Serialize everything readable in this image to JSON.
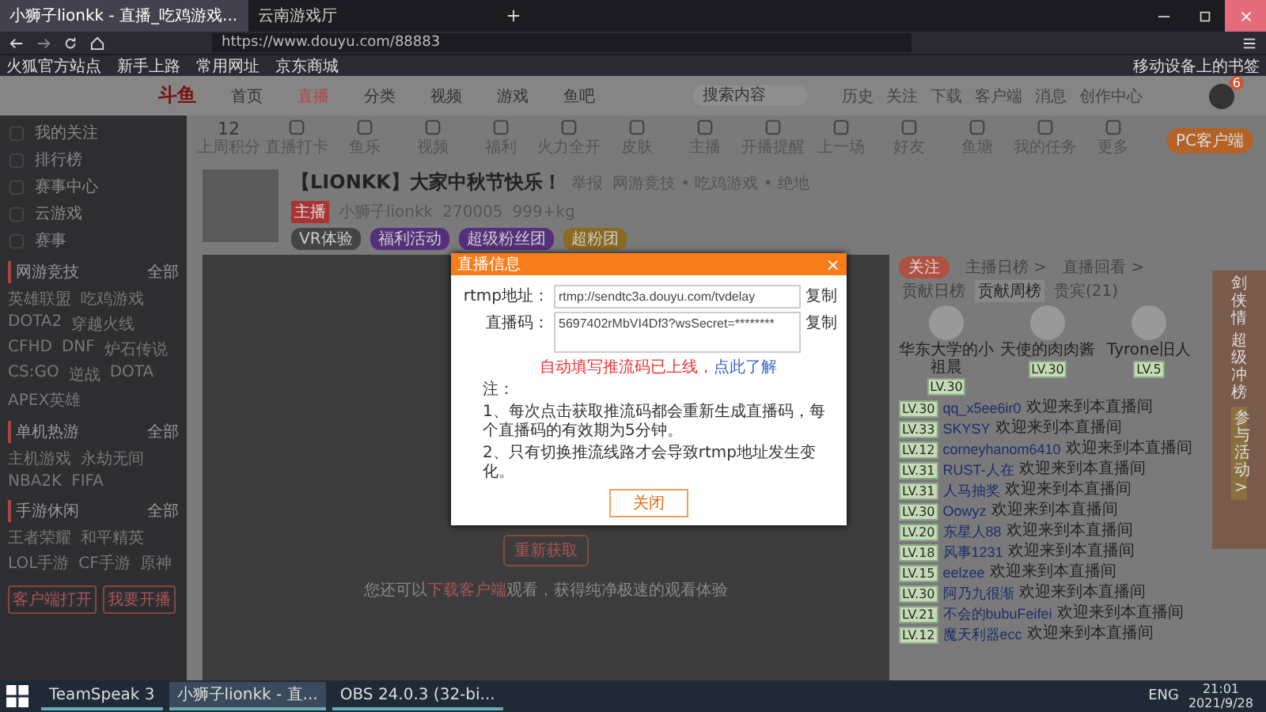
{
  "browser": {
    "tabs": [
      {
        "label": "小狮子lionkk - 直播_吃鸡游戏...",
        "selected": true
      },
      {
        "label": "云南游戏厅",
        "selected": false
      }
    ],
    "url": "https://www.douyu.com/88883",
    "bookmarks": [
      "火狐官方站点",
      "新手上路",
      "常用网址",
      "京东商城"
    ],
    "mobile_bookmarks": "移动设备上的书签"
  },
  "nav": {
    "logo": "斗鱼",
    "links": [
      {
        "label": "首页",
        "selected": false
      },
      {
        "label": "直播",
        "selected": true
      },
      {
        "label": "分类",
        "selected": false
      },
      {
        "label": "视频",
        "selected": false
      },
      {
        "label": "游戏",
        "selected": false
      },
      {
        "label": "鱼吧",
        "selected": false
      }
    ],
    "search": {
      "placeholder": "搜索内容"
    },
    "actions": [
      "历史",
      "关注",
      "下载",
      "客户端",
      "消息",
      "创作中心"
    ],
    "avatar_badge": "6"
  },
  "sidebar": {
    "items": [
      "我的关注",
      "排行榜",
      "赛事中心",
      "云游戏",
      "赛事"
    ],
    "sections": [
      {
        "title": "网游竞技",
        "more": "全部",
        "games": [
          "英雄联盟",
          "吃鸡游戏",
          "DOTA2",
          "穿越火线",
          "CFHD",
          "DNF",
          "炉石传说",
          "CS:GO",
          "逆战",
          "DOTA",
          "APEX英雄"
        ]
      },
      {
        "title": "单机热游",
        "more": "全部",
        "games": [
          "主机游戏",
          "永劫无间",
          "NBA2K",
          "FIFA"
        ]
      },
      {
        "title": "手游休闲",
        "more": "全部",
        "games": [
          "王者荣耀",
          "和平精英",
          "LOL手游",
          "CF手游",
          "原神"
        ]
      }
    ],
    "buttons": [
      "客户端打开",
      "我要开播"
    ]
  },
  "shortcuts": [
    {
      "label": "上周积分",
      "value": "12"
    },
    {
      "label": "直播打卡"
    },
    {
      "label": "鱼乐"
    },
    {
      "label": "视频"
    },
    {
      "label": "福利"
    },
    {
      "label": "火力全开"
    },
    {
      "label": "皮肤"
    },
    {
      "label": "主播"
    },
    {
      "label": "开播提醒"
    },
    {
      "label": "上一场"
    },
    {
      "label": "好友"
    },
    {
      "label": "鱼塘"
    },
    {
      "label": "我的任务"
    },
    {
      "label": "更多"
    }
  ],
  "pc_button": "PC客户端",
  "streamer": {
    "title": "【LIONKK】大家中秋节快乐！",
    "report": "举报",
    "category": "网游竞技 • 吃鸡游戏 • 绝地",
    "tag": "主播",
    "name": "小狮子lionkk",
    "heat": "270005",
    "follow_count": "999+kg",
    "badges": [
      "VR体验",
      "福利活动",
      "超级粉丝团",
      "超粉团"
    ]
  },
  "dialog": {
    "title": "直播信息",
    "close": "×",
    "rtmp_label": "rtmp地址：",
    "rtmp_value": "rtmp://sendtc3a.douyu.com/tvdelay",
    "code_label": "直播码：",
    "code_value": "5697402rMbVI4Df3?wsSecret=********",
    "rtmp_copy": "复制",
    "code_copy": "复制",
    "warning": "自动填写推流码已上线，",
    "learn_more": "点此了解",
    "notes_title": "注：",
    "notes": [
      "1、每次点击获取推流码都会重新生成直播码，每个直播码的有效期为5分钟。",
      "2、只有切换推流线路才会导致rtmp地址发生变化。"
    ],
    "button": "关闭"
  },
  "video": {
    "button": "重新获取",
    "hint": "您还可以",
    "link": "下载客户端",
    "hint_tail": "观看，获得纯净极速的观看体验"
  },
  "right": {
    "follow": "关注",
    "rank_links": [
      "主播日榜 >",
      "直播回看 >"
    ],
    "tabs": [
      {
        "label": "贡献日榜",
        "selected": false
      },
      {
        "label": "贡献周榜",
        "selected": true
      },
      {
        "label": "贵宾(21)",
        "selected": false
      }
    ],
    "top_fans": [
      {
        "name": "华东大学的小祖晨",
        "level": "LV.30"
      },
      {
        "name": "天使的肉肉酱",
        "level": "LV.30"
      },
      {
        "name": "Tyrone旧人",
        "level": "LV.5"
      }
    ],
    "chat": [
      {
        "level": "LV.30",
        "user": "qq_x5ee6ir0",
        "text": "欢迎来到本直播间"
      },
      {
        "level": "LV.33",
        "user": "SKYSY",
        "text": "欢迎来到本直播间"
      },
      {
        "level": "LV.12",
        "user": "corneyhanom6410",
        "text": "欢迎来到本直播间"
      },
      {
        "level": "LV.31",
        "user": "RUST-人在",
        "text": "欢迎来到本直播间"
      },
      {
        "level": "LV.31",
        "user": "人马抽奖",
        "text": "欢迎来到本直播间"
      },
      {
        "level": "LV.30",
        "user": "Oowyz",
        "text": "欢迎来到本直播间"
      },
      {
        "level": "LV.20",
        "user": "东星人88",
        "text": "欢迎来到本直播间"
      },
      {
        "level": "LV.18",
        "user": "风事1231",
        "text": "欢迎来到本直播间"
      },
      {
        "level": "LV.15",
        "user": "eelzee",
        "text": "欢迎来到本直播间"
      },
      {
        "level": "LV.30",
        "user": "阿乃九很渐",
        "text": "欢迎来到本直播间"
      },
      {
        "level": "LV.21",
        "user": "不会的bubuFeifei",
        "text": "欢迎来到本直播间"
      },
      {
        "level": "LV.12",
        "user": "魔天利器ecc",
        "text": "欢迎来到本直播间"
      }
    ],
    "ad": {
      "title": "剑侠情",
      "sub": "超级冲榜",
      "cta": "参与活动 >"
    }
  },
  "taskbar": {
    "apps": [
      {
        "label": "TeamSpeak 3",
        "selected": false
      },
      {
        "label": "小狮子lionkk - 直...",
        "selected": true
      },
      {
        "label": "OBS 24.0.3 (32-bi...",
        "selected": false
      }
    ],
    "lang": "ENG",
    "time": "21:01",
    "date": "2021/9/28"
  }
}
